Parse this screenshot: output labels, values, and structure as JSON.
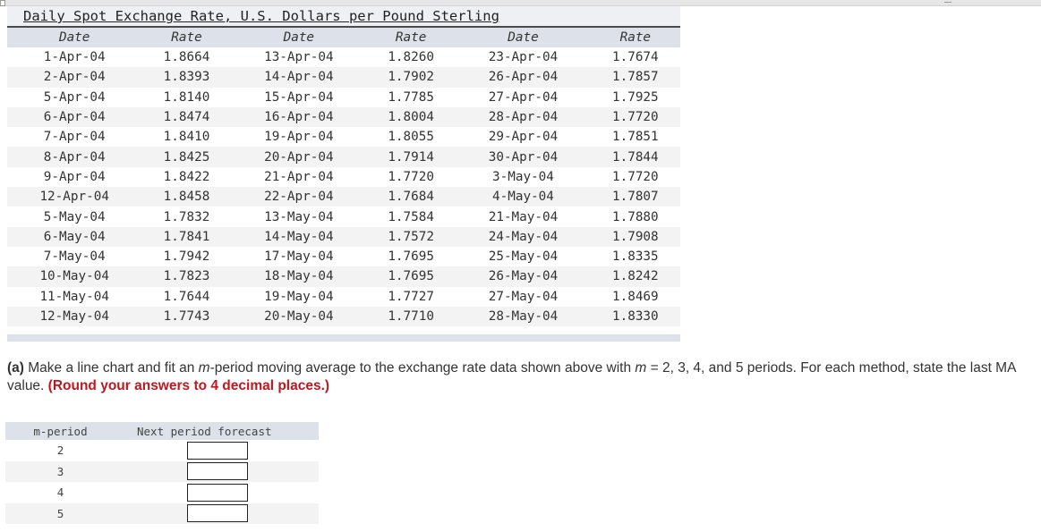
{
  "data_table": {
    "title": "Daily Spot Exchange Rate, U.S. Dollars per Pound Sterling",
    "headers": [
      "Date",
      "Rate",
      "Date",
      "Rate",
      "Date",
      "Rate"
    ],
    "rows": [
      [
        "1-Apr-04",
        "1.8664",
        "13-Apr-04",
        "1.8260",
        "23-Apr-04",
        "1.7674"
      ],
      [
        "2-Apr-04",
        "1.8393",
        "14-Apr-04",
        "1.7902",
        "26-Apr-04",
        "1.7857"
      ],
      [
        "5-Apr-04",
        "1.8140",
        "15-Apr-04",
        "1.7785",
        "27-Apr-04",
        "1.7925"
      ],
      [
        "6-Apr-04",
        "1.8474",
        "16-Apr-04",
        "1.8004",
        "28-Apr-04",
        "1.7720"
      ],
      [
        "7-Apr-04",
        "1.8410",
        "19-Apr-04",
        "1.8055",
        "29-Apr-04",
        "1.7851"
      ],
      [
        "8-Apr-04",
        "1.8425",
        "20-Apr-04",
        "1.7914",
        "30-Apr-04",
        "1.7844"
      ],
      [
        "9-Apr-04",
        "1.8422",
        "21-Apr-04",
        "1.7720",
        "3-May-04",
        "1.7720"
      ],
      [
        "12-Apr-04",
        "1.8458",
        "22-Apr-04",
        "1.7684",
        "4-May-04",
        "1.7807"
      ],
      [
        "5-May-04",
        "1.7832",
        "13-May-04",
        "1.7584",
        "21-May-04",
        "1.7880"
      ],
      [
        "6-May-04",
        "1.7841",
        "14-May-04",
        "1.7572",
        "24-May-04",
        "1.7908"
      ],
      [
        "7-May-04",
        "1.7942",
        "17-May-04",
        "1.7695",
        "25-May-04",
        "1.8335"
      ],
      [
        "10-May-04",
        "1.7823",
        "18-May-04",
        "1.7695",
        "26-May-04",
        "1.8242"
      ],
      [
        "11-May-04",
        "1.7644",
        "19-May-04",
        "1.7727",
        "27-May-04",
        "1.8469"
      ],
      [
        "12-May-04",
        "1.7743",
        "20-May-04",
        "1.7710",
        "28-May-04",
        "1.8330"
      ]
    ]
  },
  "question": {
    "part_label": "(a)",
    "text_1": " Make a line chart and fit an ",
    "m_var": "m",
    "text_2": "-period moving average to the exchange rate data shown above with ",
    "m_var_2": "m",
    "text_3": " = 2, 3, 4, and 5 periods. For each method, state the last MA value. ",
    "instruction": "(Round your answers to 4 decimal places.)"
  },
  "answer_table": {
    "header_m": "m-period",
    "header_forecast": "Next period forecast",
    "rows": [
      {
        "m": "2",
        "value": ""
      },
      {
        "m": "3",
        "value": ""
      },
      {
        "m": "4",
        "value": ""
      },
      {
        "m": "5",
        "value": ""
      }
    ]
  }
}
